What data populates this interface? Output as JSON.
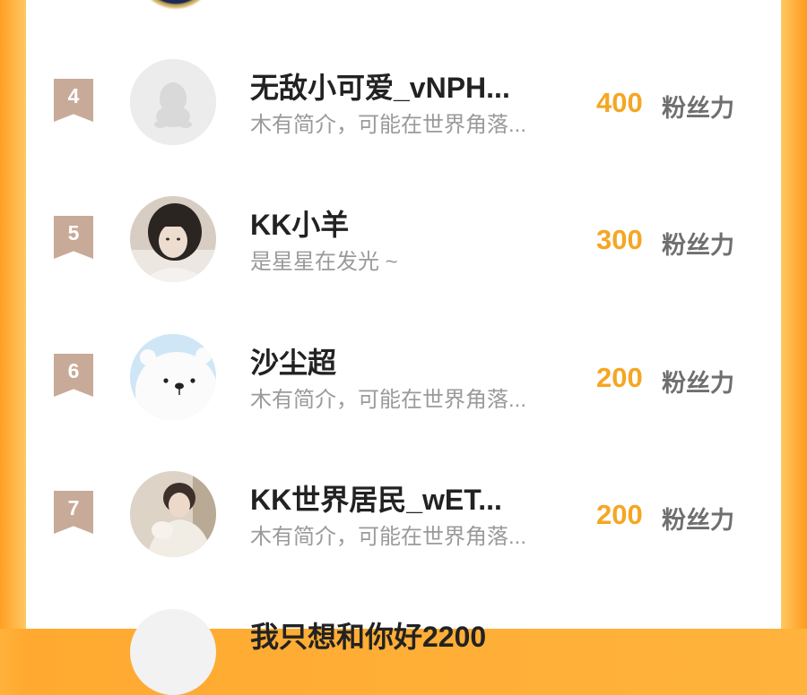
{
  "unit_label": "粉丝力",
  "colors": {
    "accent": "#f5a623",
    "badge": "#c8aa98",
    "frame": "#ffad34"
  },
  "rows": [
    {
      "rank": "4",
      "name": "无敌小可爱_vNPH...",
      "bio": "木有简介，可能在世界角落...",
      "score": "400",
      "avatar_icon": "default-penguin-icon"
    },
    {
      "rank": "5",
      "name": "KK小羊",
      "bio": "是星星在发光 ~",
      "score": "300",
      "avatar_icon": "girl-photo"
    },
    {
      "rank": "6",
      "name": "沙尘超",
      "bio": "木有简介，可能在世界角落...",
      "score": "200",
      "avatar_icon": "polar-bear-icon"
    },
    {
      "rank": "7",
      "name": "KK世界居民_wET...",
      "bio": "木有简介，可能在世界角落...",
      "score": "200",
      "avatar_icon": "boy-photo"
    }
  ],
  "next_row": {
    "name": "我只想和你好2200"
  }
}
